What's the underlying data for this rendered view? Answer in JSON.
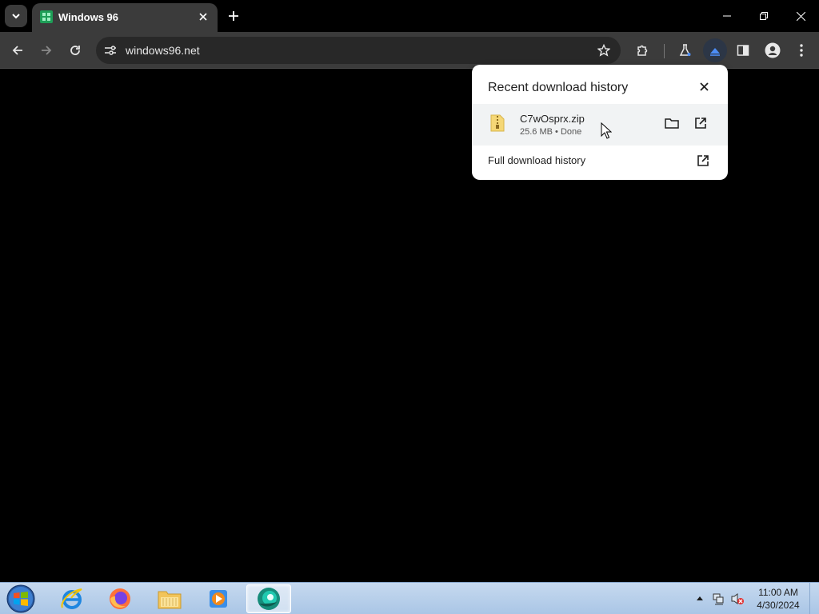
{
  "browser": {
    "tab": {
      "title": "Windows 96",
      "favicon": "windows96-favicon"
    },
    "omnibox": {
      "url": "windows96.net"
    },
    "toolbar_icons": [
      "back-icon",
      "forward-icon",
      "reload-icon",
      "site-info-icon",
      "bookmark-star-icon",
      "extensions-icon",
      "labs-icon",
      "downloads-icon",
      "side-panel-icon",
      "profile-icon",
      "menu-icon"
    ],
    "window_controls": [
      "minimize-icon",
      "restore-icon",
      "close-icon"
    ]
  },
  "download_popup": {
    "title": "Recent download history",
    "item": {
      "filename": "C7wOsprx.zip",
      "size": "25.6 MB",
      "separator": "•",
      "status": "Done"
    },
    "full_history_label": "Full download history"
  },
  "taskbar": {
    "apps": [
      "internet-explorer-icon",
      "firefox-icon",
      "file-explorer-icon",
      "media-player-icon",
      "chrome-app-icon"
    ],
    "clock": {
      "time": "11:00 AM",
      "date": "4/30/2024"
    }
  },
  "colors": {
    "toolbar": "#3b3b3b",
    "accent_blue": "#1a73e8",
    "page_bg": "#000000"
  }
}
